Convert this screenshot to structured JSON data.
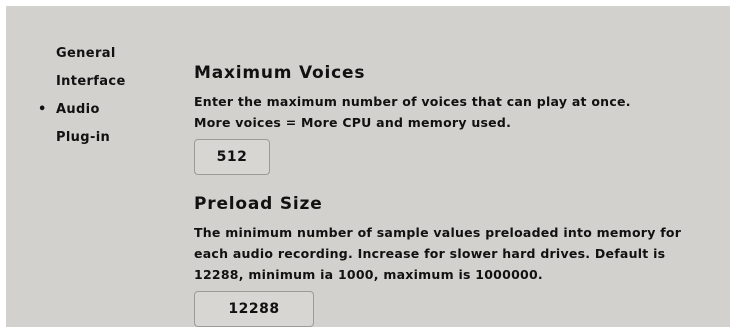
{
  "sidebar": {
    "active_bullet": "•",
    "items": [
      {
        "label": "General"
      },
      {
        "label": "Interface"
      },
      {
        "label": "Audio"
      },
      {
        "label": "Plug-in"
      }
    ]
  },
  "max_voices": {
    "title": "Maximum Voices",
    "description": [
      "Enter the maximum number of voices that can play at once.",
      "More voices = More CPU and memory used."
    ],
    "value": "512"
  },
  "preload_size": {
    "title": "Preload Size",
    "description": [
      "The minimum number of sample values preloaded into memory for",
      "each audio recording. Increase for slower hard drives. Default is",
      "12288, minimum ia 1000, maximum is 1000000."
    ],
    "value": "12288"
  },
  "colors": {
    "panel_background": "#d3d1ce",
    "text": "#111111",
    "input_border": "#9d9b98"
  }
}
